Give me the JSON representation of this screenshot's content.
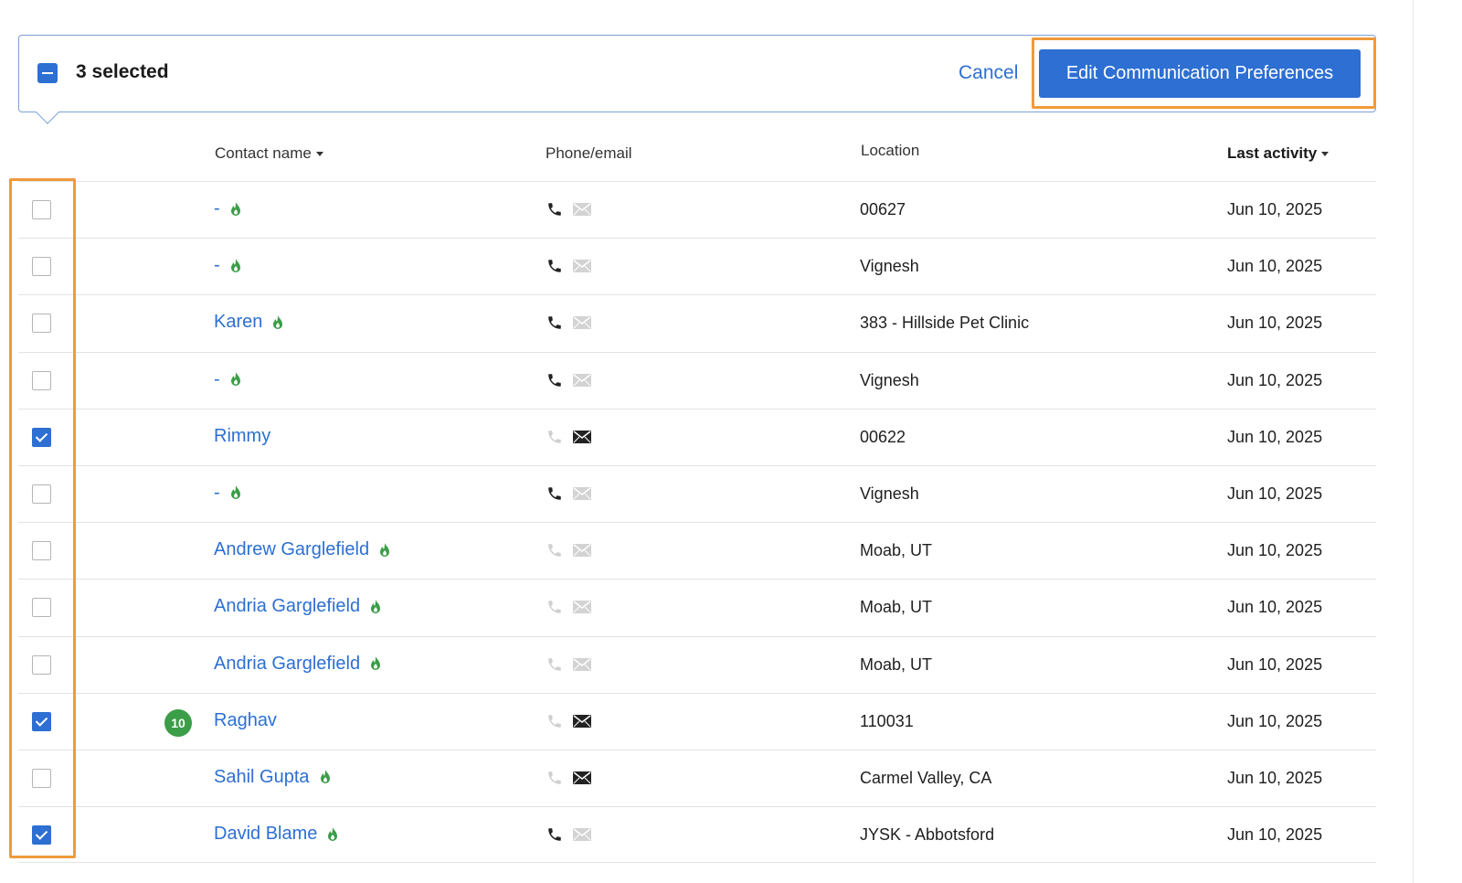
{
  "selection_bar": {
    "count_text": "3 selected",
    "cancel_label": "Cancel",
    "edit_label": "Edit Communication Preferences"
  },
  "columns": {
    "contact_name": "Contact name",
    "phone_email": "Phone/email",
    "location": "Location",
    "last_activity": "Last activity"
  },
  "colors": {
    "accent": "#2d6fd2",
    "highlight": "#ef9a3a",
    "flame": "#3b9d47"
  },
  "rows": [
    {
      "checked": false,
      "badge": "",
      "name": "-",
      "flame": true,
      "phone": "active",
      "email": "inactive",
      "location": "00627",
      "last_activity": "Jun 10, 2025"
    },
    {
      "checked": false,
      "badge": "",
      "name": "-",
      "flame": true,
      "phone": "active",
      "email": "inactive",
      "location": "Vignesh",
      "last_activity": "Jun 10, 2025"
    },
    {
      "checked": false,
      "badge": "",
      "name": "Karen",
      "flame": true,
      "phone": "active",
      "email": "inactive",
      "location": "383 - Hillside Pet Clinic",
      "last_activity": "Jun 10, 2025"
    },
    {
      "checked": false,
      "badge": "",
      "name": "-",
      "flame": true,
      "phone": "active",
      "email": "inactive",
      "location": "Vignesh",
      "last_activity": "Jun 10, 2025"
    },
    {
      "checked": true,
      "badge": "",
      "name": "Rimmy",
      "flame": false,
      "phone": "inactive",
      "email": "active",
      "location": "00622",
      "last_activity": "Jun 10, 2025"
    },
    {
      "checked": false,
      "badge": "",
      "name": "-",
      "flame": true,
      "phone": "active",
      "email": "inactive",
      "location": "Vignesh",
      "last_activity": "Jun 10, 2025"
    },
    {
      "checked": false,
      "badge": "",
      "name": "Andrew Garglefield",
      "flame": true,
      "phone": "inactive",
      "email": "inactive",
      "location": "Moab, UT",
      "last_activity": "Jun 10, 2025"
    },
    {
      "checked": false,
      "badge": "",
      "name": "Andria Garglefield",
      "flame": true,
      "phone": "inactive",
      "email": "inactive",
      "location": "Moab, UT",
      "last_activity": "Jun 10, 2025"
    },
    {
      "checked": false,
      "badge": "",
      "name": "Andria Garglefield",
      "flame": true,
      "phone": "inactive",
      "email": "inactive",
      "location": "Moab, UT",
      "last_activity": "Jun 10, 2025"
    },
    {
      "checked": true,
      "badge": "10",
      "name": "Raghav",
      "flame": false,
      "phone": "inactive",
      "email": "active",
      "location": "110031",
      "last_activity": "Jun 10, 2025"
    },
    {
      "checked": false,
      "badge": "",
      "name": "Sahil Gupta",
      "flame": true,
      "phone": "inactive",
      "email": "active",
      "location": "Carmel Valley, CA",
      "last_activity": "Jun 10, 2025"
    },
    {
      "checked": true,
      "badge": "",
      "name": "David Blame",
      "flame": true,
      "phone": "active",
      "email": "inactive",
      "location": "JYSK - Abbotsford",
      "last_activity": "Jun 10, 2025"
    }
  ]
}
